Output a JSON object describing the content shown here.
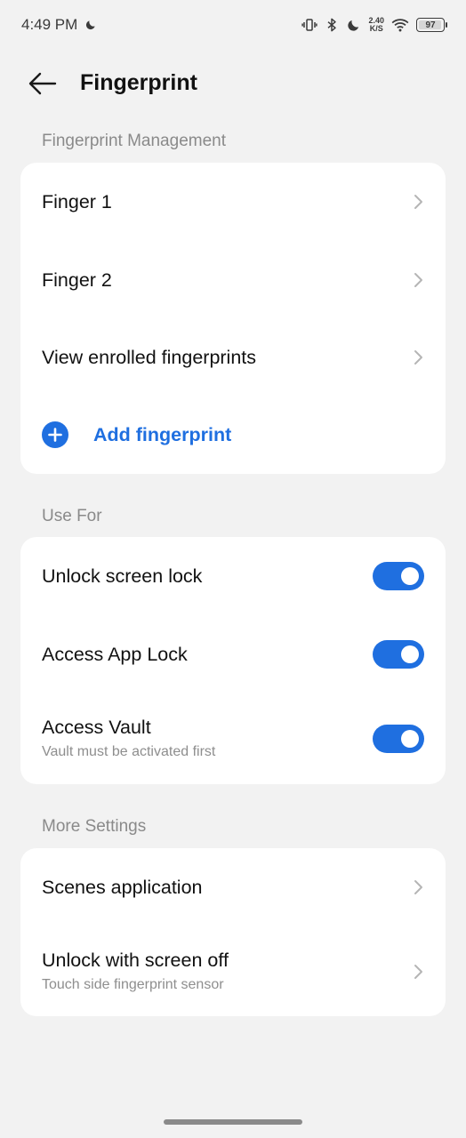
{
  "status_bar": {
    "time": "4:49 PM",
    "net_speed_value": "2.40",
    "net_speed_unit": "K/S",
    "battery": "97",
    "icons": [
      "moon-icon",
      "vibrate-icon",
      "bluetooth-icon",
      "moon-icon",
      "wifi-icon",
      "battery-icon"
    ]
  },
  "header": {
    "title": "Fingerprint"
  },
  "sections": {
    "management": {
      "label": "Fingerprint Management",
      "finger1": "Finger 1",
      "finger2": "Finger 2",
      "view_enrolled": "View enrolled fingerprints",
      "add_fingerprint": "Add fingerprint"
    },
    "use_for": {
      "label": "Use For",
      "unlock_screen_lock": "Unlock screen lock",
      "unlock_screen_lock_on": true,
      "access_app_lock": "Access App Lock",
      "access_app_lock_on": true,
      "access_vault": "Access Vault",
      "access_vault_sub": "Vault must be activated first",
      "access_vault_on": true
    },
    "more_settings": {
      "label": "More Settings",
      "scenes_application": "Scenes application",
      "unlock_screen_off": "Unlock with screen off",
      "unlock_screen_off_sub": "Touch side fingerprint sensor"
    }
  },
  "colors": {
    "accent": "#1f6fe0",
    "background": "#f2f2f2",
    "card": "#ffffff"
  }
}
